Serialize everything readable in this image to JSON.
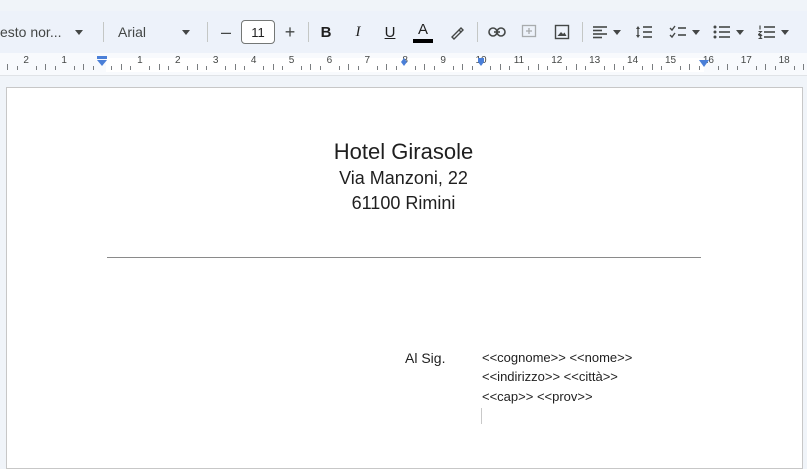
{
  "toolbar": {
    "style_select": "esto nor...",
    "font_select": "Arial",
    "font_size": "11",
    "minus_label": "–",
    "plus_label": "+",
    "bold_label": "B",
    "italic_label": "I",
    "underline_label": "U",
    "text_color_label": "A"
  },
  "ruler": {
    "numbers": [
      "2",
      "1",
      "1",
      "2",
      "3",
      "4",
      "5",
      "6",
      "7",
      "8",
      "9",
      "10",
      "11",
      "12",
      "13",
      "14",
      "15",
      "16",
      "17",
      "18"
    ]
  },
  "document": {
    "hotel_name": "Hotel Girasole",
    "street": "Via Manzoni, 22",
    "city_line": "61100 Rimini",
    "salutation": "Al Sig.",
    "field_line1": "<<cognome>> <<nome>>",
    "field_line2": "<<indirizzo>> <<città>>",
    "field_line3": "<<cap>> <<prov>>"
  }
}
